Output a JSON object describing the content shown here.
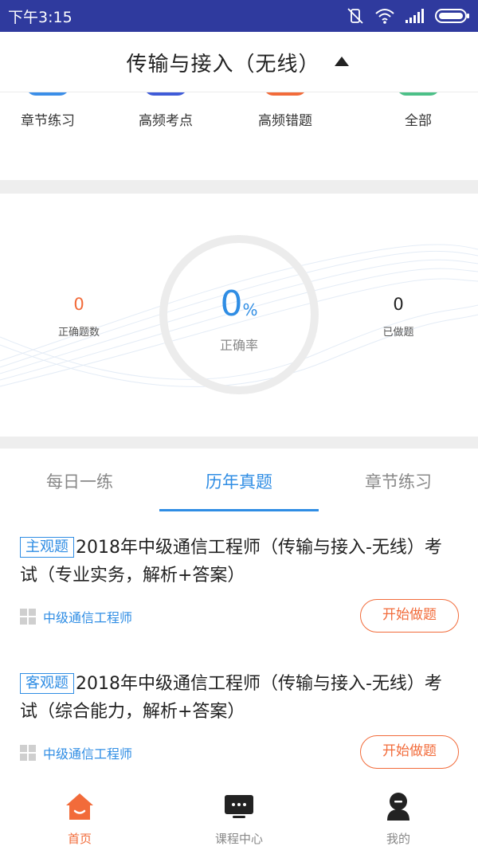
{
  "status_bar": {
    "time": "下午3:15"
  },
  "header": {
    "title": "传输与接入（无线）"
  },
  "quick_menu": [
    {
      "label": "章节练习",
      "color": "#3b8ee8"
    },
    {
      "label": "高频考点",
      "color": "#3f5bd8"
    },
    {
      "label": "高频错题",
      "color": "#f26b3a"
    },
    {
      "label": "全部",
      "color": "#4cc088"
    }
  ],
  "stats": {
    "correct_count": {
      "value": "0",
      "label": "正确题数",
      "color": "#f26b3a"
    },
    "accuracy": {
      "value": "0",
      "unit": "%",
      "label": "正确率"
    },
    "done_count": {
      "value": "0",
      "label": "已做题",
      "color": "#222222"
    }
  },
  "tabs": [
    {
      "label": "每日一练",
      "active": false
    },
    {
      "label": "历年真题",
      "active": true
    },
    {
      "label": "章节练习",
      "active": false
    }
  ],
  "exams": [
    {
      "type": "主观题",
      "title": "2018年中级通信工程师（传输与接入-无线）考试（专业实务，解析+答案）",
      "category": "中级通信工程师",
      "button": "开始做题"
    },
    {
      "type": "客观题",
      "title": "2018年中级通信工程师（传输与接入-无线）考试（综合能力，解析+答案）",
      "category": "中级通信工程师",
      "button": "开始做题"
    }
  ],
  "bottom_nav": [
    {
      "label": "首页",
      "icon": "home-icon",
      "active": true
    },
    {
      "label": "课程中心",
      "icon": "course-center-icon",
      "active": false
    },
    {
      "label": "我的",
      "icon": "profile-icon",
      "active": false
    }
  ],
  "colors": {
    "accent_blue": "#2f8de4",
    "accent_orange": "#f26b3a",
    "status_bar": "#2f3a9e"
  }
}
